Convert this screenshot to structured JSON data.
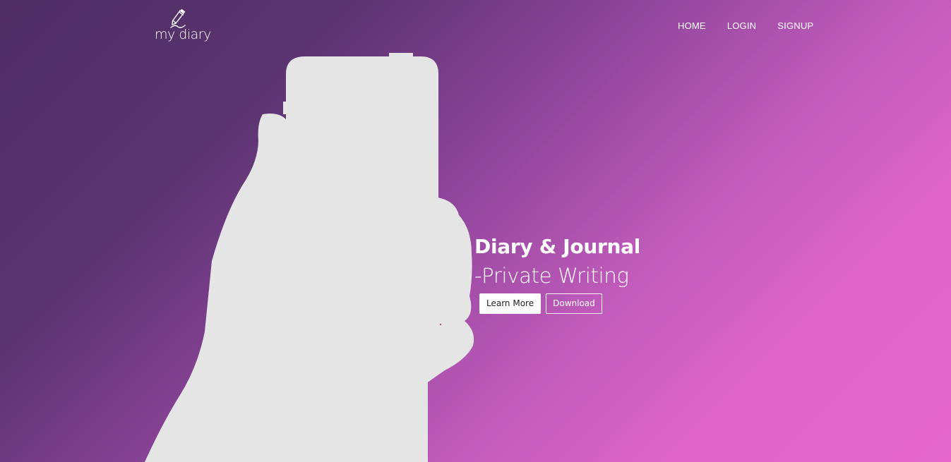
{
  "brand": {
    "logo_text": "my diary",
    "logo_icon": "pencil-icon"
  },
  "nav": {
    "home": "HOME",
    "login": "LOGIN",
    "signup": "SIGNUP"
  },
  "hero": {
    "headline": "Diary & Journal",
    "subline": "-Private Writing",
    "learn_more": "Learn More",
    "download": "Download",
    "illustration": "hand-holding-phone"
  },
  "colors": {
    "gradient_start": "#4f2e64",
    "gradient_end": "#e567cc",
    "illustration": "#e5e5e5",
    "text": "#ffffff"
  }
}
